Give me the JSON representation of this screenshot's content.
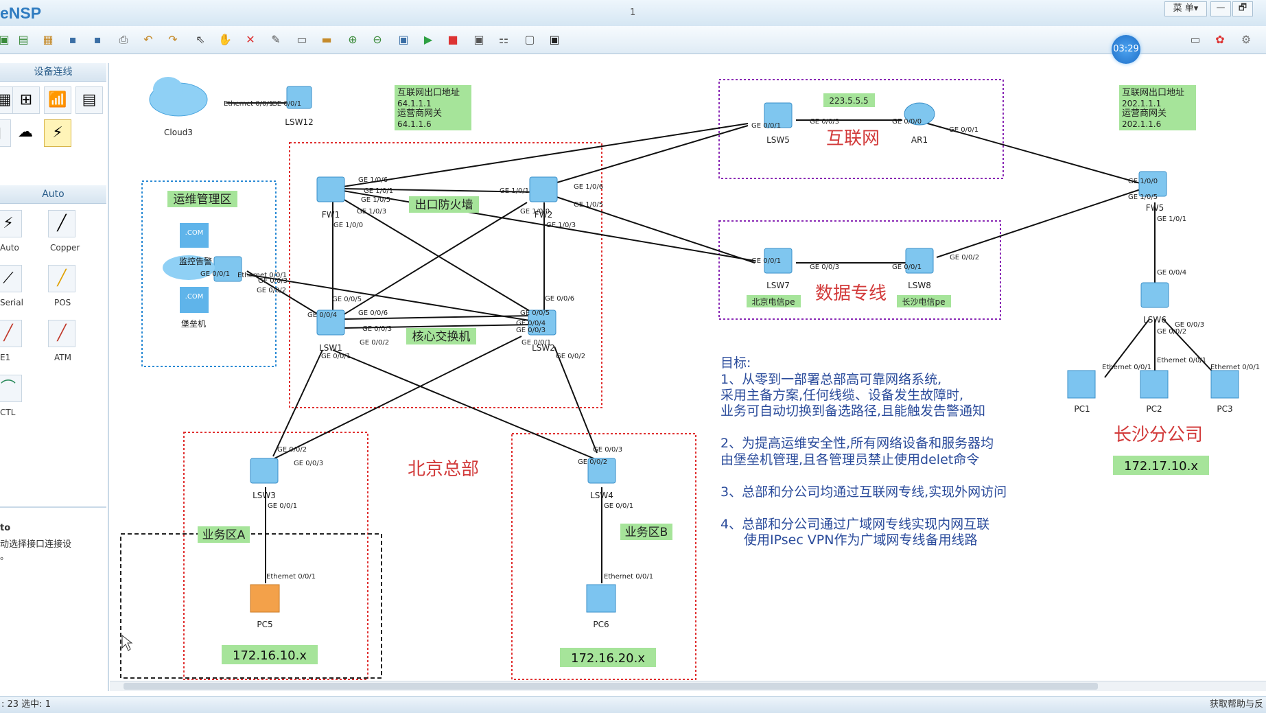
{
  "app": {
    "title": "eNSP",
    "center_title": "1",
    "menu_label": "菜 单▾",
    "minimize": "—",
    "restore": "🗗"
  },
  "timer": "03:29",
  "sidebar": {
    "header1": "设备连线",
    "header2": "Auto",
    "items": [
      {
        "label": "Auto",
        "icon": "⚡"
      },
      {
        "label": "Copper",
        "icon": "╱"
      },
      {
        "label": "Serial",
        "icon": "⟋"
      },
      {
        "label": "POS",
        "icon": "╱"
      },
      {
        "label": "E1",
        "icon": "╱"
      },
      {
        "label": "ATM",
        "icon": "╱"
      },
      {
        "label": "CTL",
        "icon": "⌒"
      }
    ],
    "info_title": "to",
    "info_text": "动选择接口连接设",
    "info_text2": "。"
  },
  "status": {
    "left": ": 23  选中: 1",
    "right": "获取帮助与反"
  },
  "diagram": {
    "zones": {
      "ops": "运维管理区",
      "fw": "出口防火墙",
      "core": "核心交换机",
      "internet": "互联网",
      "dataline": "数据专线",
      "beijing": "北京总部",
      "changsha": "长沙分公司",
      "bizA": "业务区A",
      "bizB": "业务区B",
      "bj_telecom": "北京电信pe",
      "cs_telecom": "长沙电信pe"
    },
    "notes": {
      "left_title": "互联网出口地址",
      "left_ip": "64.1.1.1",
      "left_gw_title": "运营商网关",
      "left_gw": "64.1.1.6",
      "right_title": "互联网出口地址",
      "right_ip": "202.1.1.1",
      "right_gw_title": "运营商网关",
      "right_gw": "202.1.1.6",
      "dns": "223.5.5.5"
    },
    "subnets": {
      "bizA": "172.16.10.x",
      "bizB": "172.16.20.x",
      "changsha": "172.17.10.x"
    },
    "goals": [
      "目标:",
      "1、从零到一部署总部高可靠网络系统,",
      "采用主备方案,任何线缆、设备发生故障时,",
      "业务可自动切换到备选路径,且能触发告警通知",
      "2、为提高运维安全性,所有网络设备和服务器均",
      "由堡垒机管理,且各管理员禁止使用delet命令",
      "3、总部和分公司均通过互联网专线,实现外网访问",
      "4、总部和分公司通过广域网专线实现内网互联",
      "使用IPsec VPN作为广域网专线备用线路"
    ],
    "devices": {
      "cloud3": "Cloud3",
      "lsw12": "LSW12",
      "fw1": "FW1",
      "fw2": "FW2",
      "lsw1": "LSW1",
      "lsw2": "LSW2",
      "lsw3": "LSW3",
      "lsw4": "LSW4",
      "lsw5": "LSW5",
      "ar1": "AR1",
      "lsw7": "LSW7",
      "lsw8": "LSW8",
      "fw5": "FW5",
      "lsw6": "LSW6",
      "pc1": "PC1",
      "pc2": "PC2",
      "pc3": "PC3",
      "pc5": "PC5",
      "pc6": "PC6",
      "monitor": "监控告警",
      "bastion": "堡垒机",
      "com1": ".COM",
      "com2": ".COM"
    },
    "ports": {
      "eth001": "Ethernet 0/0/1",
      "ge001": "GE 0/0/1",
      "ge002": "GE 0/0/2",
      "ge003": "GE 0/0/3",
      "ge004": "GE 0/0/4",
      "ge005": "GE 0/0/5",
      "ge006": "GE 0/0/6",
      "ge000": "GE 0/0/0",
      "ge100": "GE 1/0/0",
      "ge101": "GE 1/0/1",
      "ge103": "GE 1/0/3",
      "ge105": "GE 1/0/5",
      "ge106": "GE 1/0/6",
      "cloud_eth": "Ethernet 0/0/1",
      "lsw12_ge": "GE 0/0/1"
    }
  }
}
